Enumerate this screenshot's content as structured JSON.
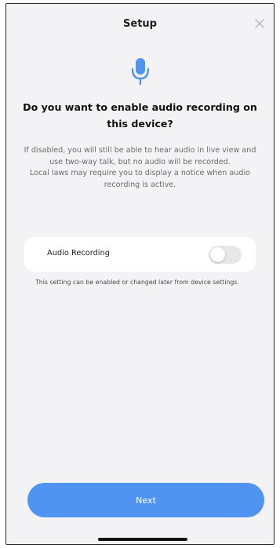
{
  "header": {
    "title": "Setup",
    "close_icon": "close-icon"
  },
  "hero": {
    "icon": "microphone-icon",
    "accent_color": "#4f94f0"
  },
  "question": "Do you want to enable audio recording on this device?",
  "description": {
    "line1": "If disabled, you will still be able to hear audio in live view and use two-way talk, but no audio will be recorded.",
    "line2": "Local laws may require you to display a notice when audio recording is active."
  },
  "setting": {
    "label": "Audio Recording",
    "enabled": false,
    "note": "This setting can be enabled or changed later from device settings."
  },
  "actions": {
    "next_label": "Next"
  }
}
